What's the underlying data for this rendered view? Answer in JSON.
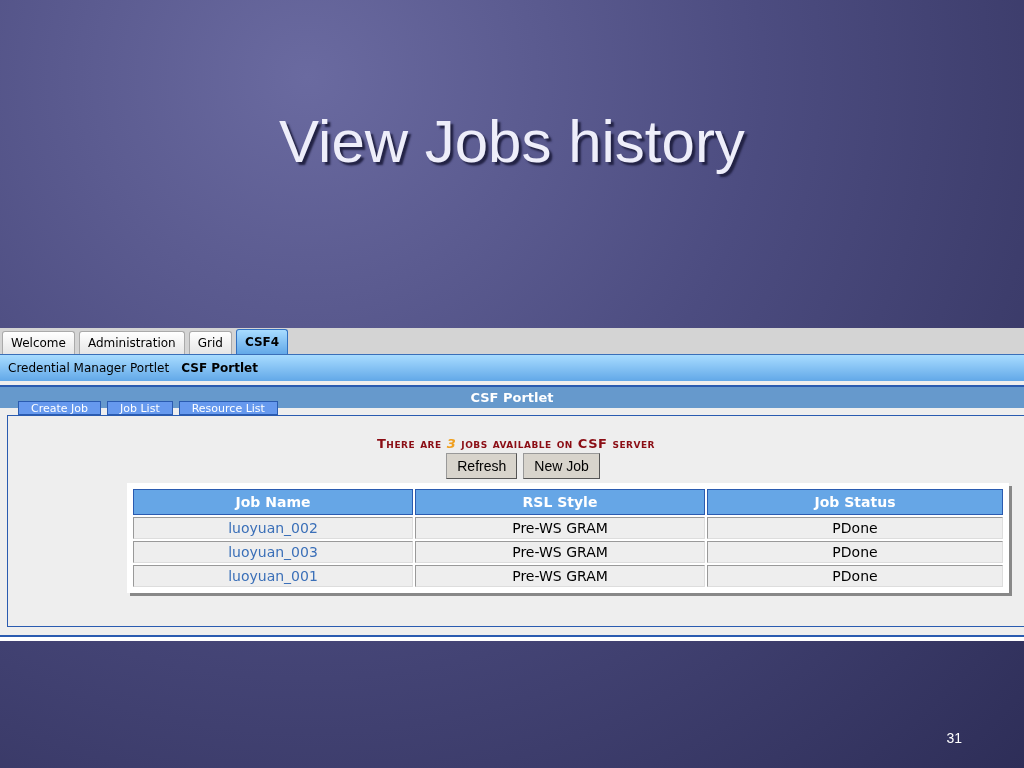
{
  "slide": {
    "title": "View Jobs history",
    "number": "31"
  },
  "tabs": [
    {
      "label": "Welcome",
      "selected": false
    },
    {
      "label": "Administration",
      "selected": false
    },
    {
      "label": "Grid",
      "selected": false
    },
    {
      "label": "CSF4",
      "selected": true
    }
  ],
  "portlet_links": [
    {
      "label": "Credential Manager Portlet",
      "selected": false
    },
    {
      "label": "CSF Portlet",
      "selected": true
    }
  ],
  "portlet": {
    "title": "CSF Portlet",
    "sub_tabs": [
      "Create Job",
      "Job List",
      "Resource List"
    ],
    "message": {
      "before": "There are",
      "count": "3",
      "after": "jobs available on CSF server"
    },
    "buttons": [
      "Refresh",
      "New Job"
    ],
    "table": {
      "columns": [
        "Job Name",
        "RSL Style",
        "Job Status"
      ],
      "rows": [
        {
          "name": "luoyuan_002",
          "style": "Pre-WS GRAM",
          "status": "PDone"
        },
        {
          "name": "luoyuan_003",
          "style": "Pre-WS GRAM",
          "status": "PDone"
        },
        {
          "name": "luoyuan_001",
          "style": "Pre-WS GRAM",
          "status": "PDone"
        }
      ]
    }
  }
}
